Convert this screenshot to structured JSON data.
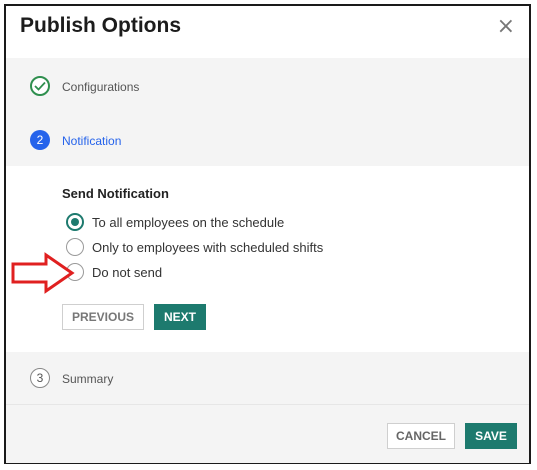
{
  "dialog": {
    "title": "Publish Options",
    "close_glyph": "×"
  },
  "steps": [
    {
      "number": "",
      "label": "Configurations",
      "status": "completed",
      "icon": "check-icon"
    },
    {
      "number": "2",
      "label": "Notification",
      "status": "active"
    },
    {
      "number": "3",
      "label": "Summary",
      "status": "pending"
    }
  ],
  "notification": {
    "title": "Send Notification",
    "options": [
      {
        "label": "To all employees on the schedule",
        "selected": true
      },
      {
        "label": "Only to employees with scheduled shifts",
        "selected": false
      },
      {
        "label": "Do not send",
        "selected": false
      }
    ],
    "previous_label": "PREVIOUS",
    "next_label": "NEXT"
  },
  "footer": {
    "cancel_label": "CANCEL",
    "save_label": "SAVE"
  },
  "colors": {
    "accent": "#1d7a6e",
    "active_step": "#2563eb",
    "completed_step": "#2f8f4e",
    "annotation_arrow": "#e02020"
  },
  "icons": {
    "close": "close-icon",
    "annotation": "arrow-right-icon"
  }
}
